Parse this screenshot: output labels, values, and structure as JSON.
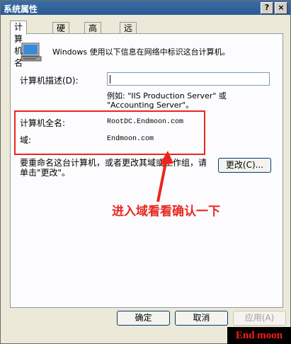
{
  "window": {
    "title": "系统属性",
    "help": "?",
    "close": "×"
  },
  "tabs": [
    {
      "label": "计算机名",
      "active": true
    },
    {
      "label": "硬件",
      "active": false
    },
    {
      "label": "高级",
      "active": false
    },
    {
      "label": "远程",
      "active": false
    }
  ],
  "info": {
    "text": "Windows 使用以下信息在网络中标识这台计算机。"
  },
  "description": {
    "label": "计算机描述(D):",
    "value": "",
    "example_line1": "例如: \"IIS Production Server\" 或",
    "example_line2": "\"Accounting Server\"。"
  },
  "identity": {
    "full_name_label": "计算机全名:",
    "full_name_value": "RootDC.Endmoon.com",
    "domain_label": "域:",
    "domain_value": "Endmoon.com"
  },
  "change": {
    "text_line1": "要重命名这台计算机，或者更改其域或工作组，请",
    "text_line2": "单击\"更改\"。",
    "button": "更改(C)..."
  },
  "annotation": {
    "text": "进入域看看确认一下",
    "color": "#e8271e"
  },
  "footer": {
    "ok": "确定",
    "cancel": "取消",
    "apply": "应用(A)"
  },
  "watermark": {
    "text": "End moon"
  }
}
